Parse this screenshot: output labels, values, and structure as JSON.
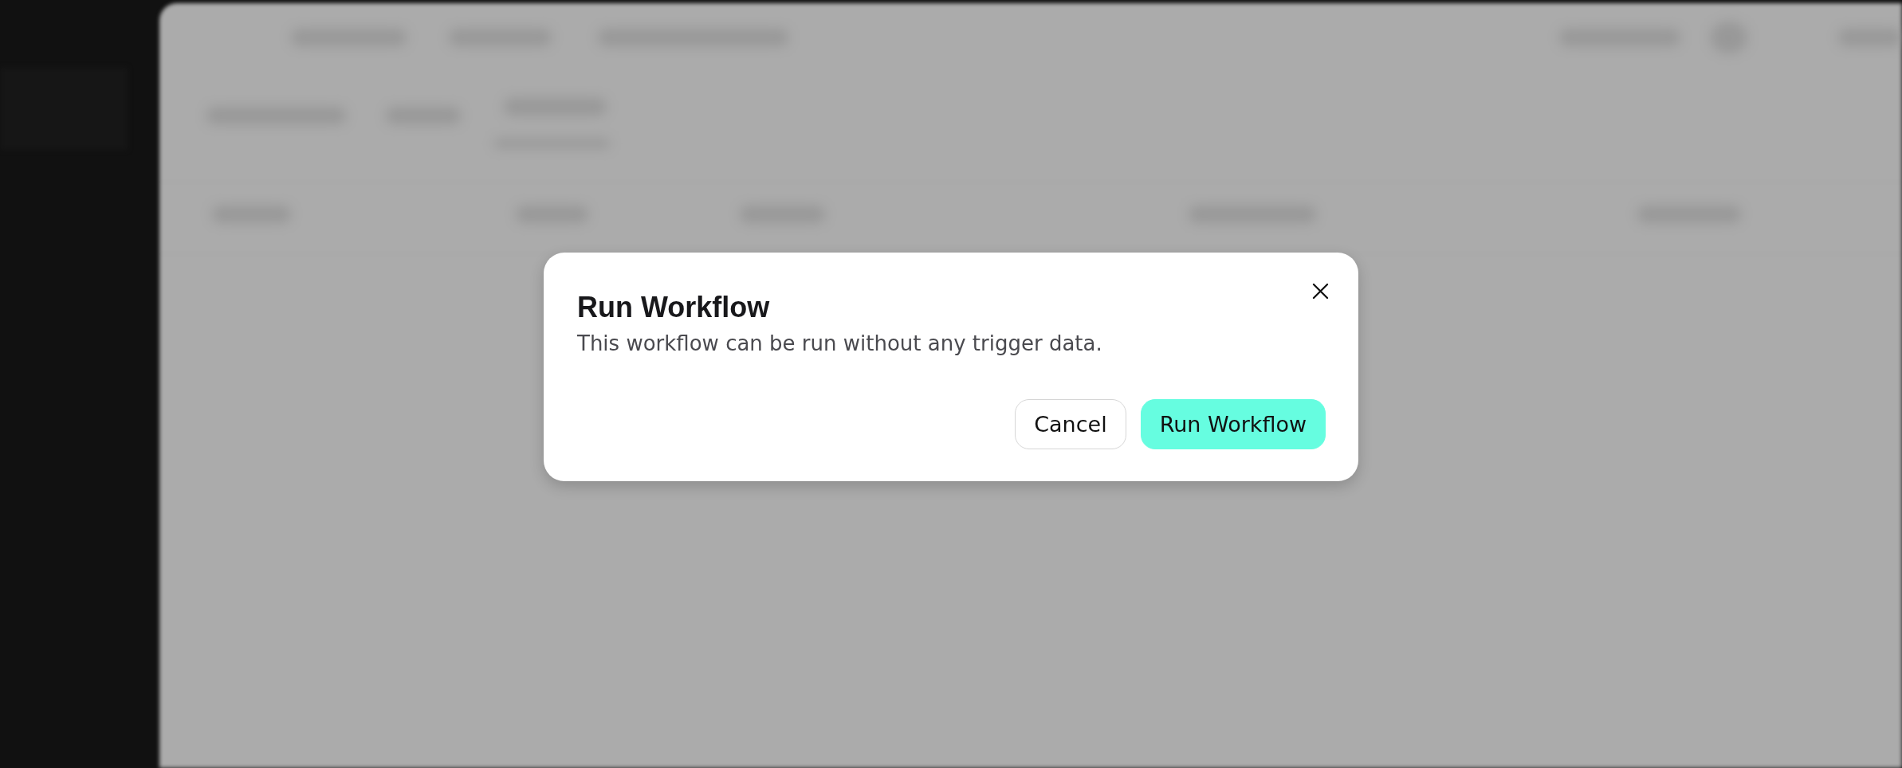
{
  "dialog": {
    "title": "Run Workflow",
    "message": "This workflow can be run without any trigger data.",
    "dismissible": true,
    "buttons": [
      {
        "label": "Cancel",
        "kind": "secondary"
      },
      {
        "label": "Run Workflow",
        "kind": "primary"
      }
    ]
  }
}
